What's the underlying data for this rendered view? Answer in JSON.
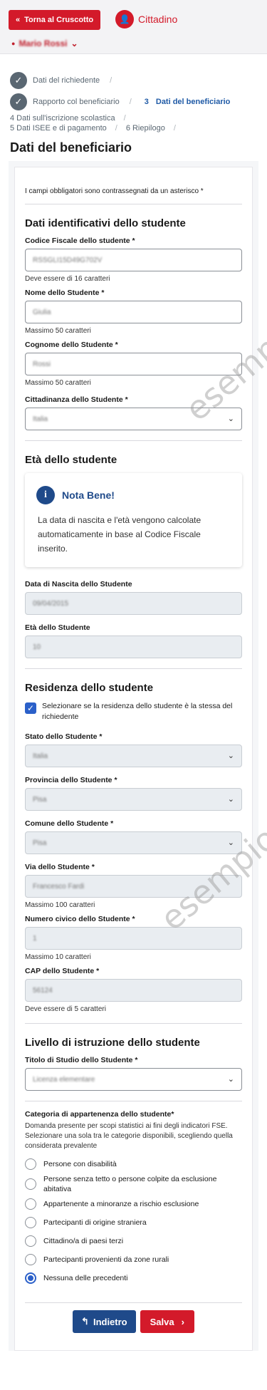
{
  "topbar": {
    "back_label": "Torna al Cruscotto",
    "role_label": "Cittadino",
    "user_name": "Mario Rossi"
  },
  "steps": {
    "step1": "Dati del richiedente",
    "step2": "Rapporto col beneficiario",
    "step3_num": "3",
    "step3": "Dati del beneficiario",
    "step4": "4  Dati sull'iscrizione scolastica",
    "step5": "5  Dati ISEE e di pagamento",
    "step6": "6  Riepilogo"
  },
  "page": {
    "title": "Dati del beneficiario",
    "required_note": "I campi obbligatori sono contrassegnati da un asterisco *"
  },
  "identificativi": {
    "title": "Dati identificativi dello studente",
    "cf_label": "Codice Fiscale dello studente *",
    "cf_value": "RSSGLI15D49G702V",
    "cf_hint": "Deve essere di 16 caratteri",
    "nome_label": "Nome dello Studente *",
    "nome_value": "Giulia",
    "nome_hint": "Massimo 50 caratteri",
    "cognome_label": "Cognome dello Studente *",
    "cognome_value": "Rossi",
    "cognome_hint": "Massimo 50 caratteri",
    "cittadinanza_label": "Cittadinanza dello Studente *",
    "cittadinanza_value": "Italia"
  },
  "eta": {
    "title": "Età dello studente",
    "notice_title": "Nota Bene!",
    "notice_text": "La data di nascita e l'età vengono calcolate automaticamente in base al Codice Fiscale inserito.",
    "nascita_label": "Data di Nascita dello Studente",
    "nascita_value": "09/04/2015",
    "eta_label": "Età dello Studente",
    "eta_value": "10"
  },
  "residenza": {
    "title": "Residenza dello studente",
    "checkbox_label": "Selezionare se la residenza dello studente è la stessa del richiedente",
    "stato_label": "Stato dello Studente *",
    "stato_value": "Italia",
    "provincia_label": "Provincia dello Studente *",
    "provincia_value": "Pisa",
    "comune_label": "Comune dello Studente *",
    "comune_value": "Pisa",
    "via_label": "Via dello Studente *",
    "via_value": "Francesco Fardi",
    "via_hint": "Massimo 100 caratteri",
    "civico_label": "Numero civico dello Studente *",
    "civico_value": "1",
    "civico_hint": "Massimo 10 caratteri",
    "cap_label": "CAP dello Studente *",
    "cap_value": "56124",
    "cap_hint": "Deve essere di 5 caratteri"
  },
  "istruzione": {
    "title": "Livello di istruzione dello studente",
    "titolo_label": "Titolo di Studio dello Studente *",
    "titolo_value": "Licenza elementare"
  },
  "categoria": {
    "title": "Categoria di appartenenza dello studente*",
    "desc": "Domanda presente per scopi statistici ai fini degli indicatori FSE. Selezionare una sola tra le categorie disponibili, scegliendo quella considerata prevalente",
    "options": [
      "Persone con disabilità",
      "Persone senza tetto o persone colpite da esclusione abitativa",
      "Appartenente a minoranze a rischio esclusione",
      "Partecipanti di origine straniera",
      "Cittadino/a di paesi terzi",
      "Partecipanti provenienti da zone rurali",
      "Nessuna delle precedenti"
    ],
    "selected_index": 6
  },
  "actions": {
    "prev_label": "Indietro",
    "save_label": "Salva"
  },
  "watermark": "esempio"
}
